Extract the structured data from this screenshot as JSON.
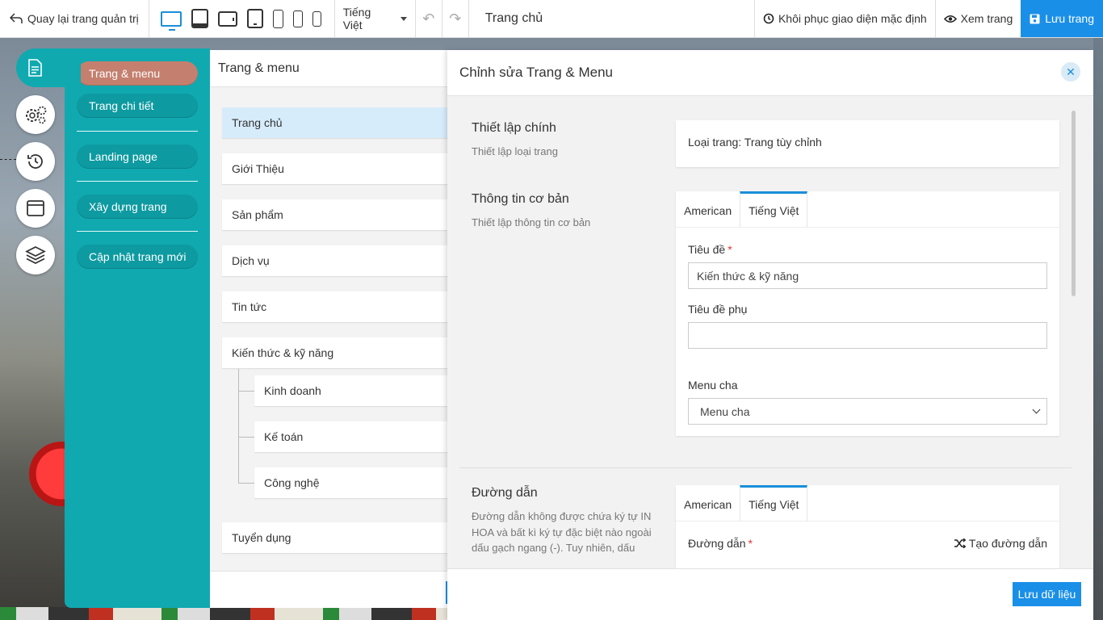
{
  "topbar": {
    "back_label": "Quay lại trang quản trị",
    "language": "Tiếng Việt",
    "page_title": "Trang chủ",
    "restore_label": "Khôi phục giao diện mặc định",
    "view_label": "Xem trang",
    "save_label": "Lưu trang"
  },
  "menu": {
    "items": [
      "Trang & menu",
      "Trang chi tiết",
      "Landing page",
      "Xây dựng trang",
      "Cập nhật trang mới"
    ]
  },
  "pages": {
    "title": "Trang & menu",
    "items": [
      "Trang chủ",
      "Giới Thiệu",
      "Sản phẩm",
      "Dịch vụ",
      "Tin tức",
      "Kiến thức & kỹ năng"
    ],
    "sub_items": [
      "Kinh doanh",
      "Kế toán",
      "Công nghệ"
    ],
    "last_item": "Tuyển dụng"
  },
  "modal": {
    "title": "Chỉnh sửa Trang & Menu",
    "main_settings": {
      "title": "Thiết lập chính",
      "desc": "Thiết lập loại trang",
      "page_type": "Loại trang: Trang tùy chỉnh"
    },
    "basic_info": {
      "title": "Thông tin cơ bản",
      "desc": "Thiết lập thông tin cơ bản",
      "tabs": [
        "American",
        "Tiếng Việt"
      ],
      "title_label": "Tiêu đề",
      "title_value": "Kiến thức & kỹ năng",
      "subtitle_label": "Tiêu đề phụ",
      "subtitle_value": "",
      "parent_label": "Menu cha",
      "parent_value": "Menu cha"
    },
    "path": {
      "title": "Đường dẫn",
      "desc": "Đường dẫn không được chứa ký tự IN HOA và bất kì ký tự đặc biệt nào ngoài dấu gạch ngang (-). Tuy nhiên, dấu",
      "tabs": [
        "American",
        "Tiếng Việt"
      ],
      "path_label": "Đường dẫn",
      "generate_label": "Tạo đường dẫn"
    },
    "save_button": "Lưu dữ liệu"
  },
  "colors": {
    "accent": "#1a8fe8",
    "teal": "#10a9b0",
    "active_pill": "#c57f6e"
  }
}
